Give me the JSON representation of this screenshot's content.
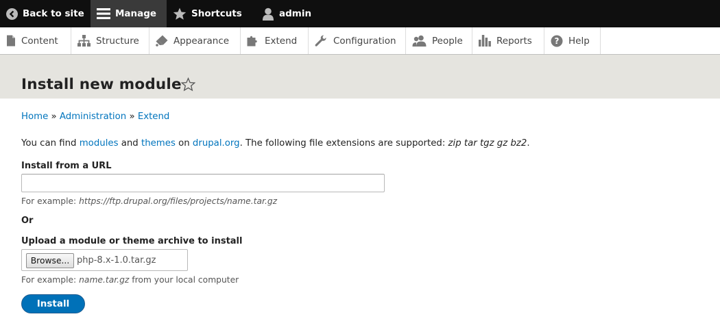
{
  "toolbar": {
    "back_label": "Back to site",
    "manage_label": "Manage",
    "shortcuts_label": "Shortcuts",
    "user_label": "admin"
  },
  "tray": {
    "items": [
      {
        "label": "Content",
        "icon": "file-icon"
      },
      {
        "label": "Structure",
        "icon": "sitemap-icon"
      },
      {
        "label": "Appearance",
        "icon": "paintbrush-icon"
      },
      {
        "label": "Extend",
        "icon": "puzzle-icon"
      },
      {
        "label": "Configuration",
        "icon": "wrench-icon"
      },
      {
        "label": "People",
        "icon": "people-icon"
      },
      {
        "label": "Reports",
        "icon": "bar-chart-icon"
      },
      {
        "label": "Help",
        "icon": "help-icon"
      }
    ]
  },
  "page": {
    "title": "Install new module"
  },
  "breadcrumb": {
    "home": "Home",
    "sep": "»",
    "administration": "Administration",
    "extend": "Extend"
  },
  "intro": {
    "prefix": "You can find ",
    "modules": "modules",
    "and": " and ",
    "themes": "themes",
    "on": " on ",
    "drupal": "drupal.org",
    "suffix": ". The following file extensions are supported: ",
    "extensions": "zip tar tgz gz bz2",
    "end": "."
  },
  "url_field": {
    "label": "Install from a URL",
    "value": "",
    "desc_prefix": "For example: ",
    "desc_example": "https://ftp.drupal.org/files/projects/name.tar.gz"
  },
  "or_label": "Or",
  "upload_field": {
    "label": "Upload a module or theme archive to install",
    "browse_label": "Browse...",
    "file_name": "php-8.x-1.0.tar.gz",
    "desc_prefix": "For example: ",
    "desc_example": "name.tar.gz",
    "desc_suffix": " from your local computer"
  },
  "install_label": "Install",
  "colors": {
    "toolbar_bg": "#0f0f0f",
    "header_bg": "#e5e4df",
    "link": "#0074bd",
    "primary_button": "#0071b8"
  }
}
